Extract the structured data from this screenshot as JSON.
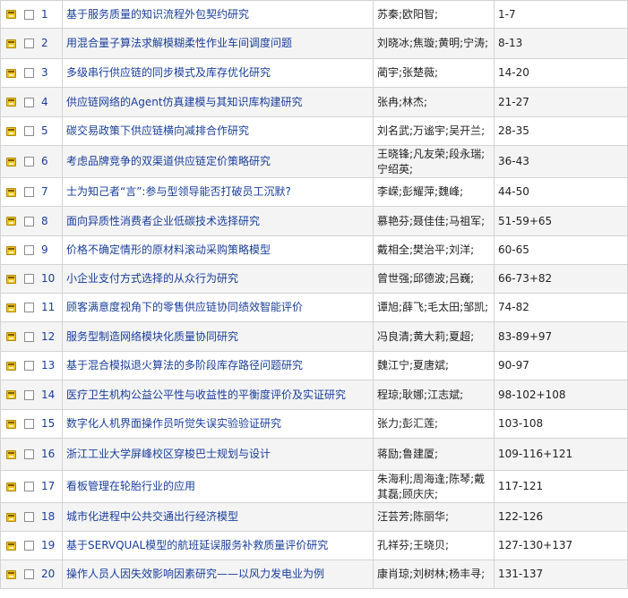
{
  "rows": [
    {
      "num": "1",
      "title": "基于服务质量的知识流程外包契约研究",
      "authors": "苏秦;欧阳智;",
      "pages": "1-7"
    },
    {
      "num": "2",
      "title": "用混合量子算法求解模糊柔性作业车间调度问题",
      "authors": "刘晓冰;焦璇;黄明;宁涛;",
      "pages": "8-13"
    },
    {
      "num": "3",
      "title": "多级串行供应链的同步模式及库存优化研究",
      "authors": "蔺宇;张楚薇;",
      "pages": "14-20"
    },
    {
      "num": "4",
      "title": "供应链网络的Agent仿真建模与其知识库构建研究",
      "authors": "张冉;林杰;",
      "pages": "21-27"
    },
    {
      "num": "5",
      "title": "碳交易政策下供应链横向减排合作研究",
      "authors": "刘名武;万谧宇;吴开兰;",
      "pages": "28-35"
    },
    {
      "num": "6",
      "title": "考虑品牌竞争的双渠道供应链定价策略研究",
      "authors": "王晓锋;凡友荣;段永瑞;宁绍英;",
      "pages": "36-43"
    },
    {
      "num": "7",
      "title": "士为知己者“言”:参与型领导能否打破员工沉默?",
      "authors": "李嵘;彭耀萍;魏峰;",
      "pages": "44-50"
    },
    {
      "num": "8",
      "title": "面向异质性消费者企业低碳技术选择研究",
      "authors": "慕艳芬;聂佳佳;马祖军;",
      "pages": "51-59+65"
    },
    {
      "num": "9",
      "title": "价格不确定情形的原材料滚动采购策略模型",
      "authors": "戴相全;樊治平;刘洋;",
      "pages": "60-65"
    },
    {
      "num": "10",
      "title": "小企业支付方式选择的从众行为研究",
      "authors": "曾世强;邱德波;吕巍;",
      "pages": "66-73+82"
    },
    {
      "num": "11",
      "title": "顾客满意度视角下的零售供应链协同绩效智能评价",
      "authors": "谭旭;薛飞;毛太田;邹凯;",
      "pages": "74-82"
    },
    {
      "num": "12",
      "title": "服务型制造网络模块化质量协同研究",
      "authors": "冯良清;黄大莉;夏超;",
      "pages": "83-89+97"
    },
    {
      "num": "13",
      "title": "基于混合模拟退火算法的多阶段库存路径问题研究",
      "authors": "魏江宁;夏唐斌;",
      "pages": "90-97"
    },
    {
      "num": "14",
      "title": "医疗卫生机构公益公平性与收益性的平衡度评价及实证研究",
      "authors": "程琼;耿娜;江志斌;",
      "pages": "98-102+108"
    },
    {
      "num": "15",
      "title": "数字化人机界面操作员听觉失误实验验证研究",
      "authors": "张力;彭汇莲;",
      "pages": "103-108"
    },
    {
      "num": "16",
      "title": "浙江工业大学屏峰校区穿梭巴士规划与设计",
      "authors": "蒋励;鲁建厦;",
      "pages": "109-116+121"
    },
    {
      "num": "17",
      "title": "看板管理在轮胎行业的应用",
      "authors": "朱海利;周海逢;陈琴;戴其磊;顾庆庆;",
      "pages": "117-121"
    },
    {
      "num": "18",
      "title": "城市化进程中公共交通出行经济模型",
      "authors": "汪芸芳;陈丽华;",
      "pages": "122-126"
    },
    {
      "num": "19",
      "title": "基于SERVQUAL模型的航班延误服务补救质量评价研究",
      "authors": "孔祥芬;王晓贝;",
      "pages": "127-130+137"
    },
    {
      "num": "20",
      "title": "操作人员人因失效影响因素研究——以风力发电业为例",
      "authors": "康肖琼;刘树林;杨丰寻;",
      "pages": "131-137"
    }
  ]
}
